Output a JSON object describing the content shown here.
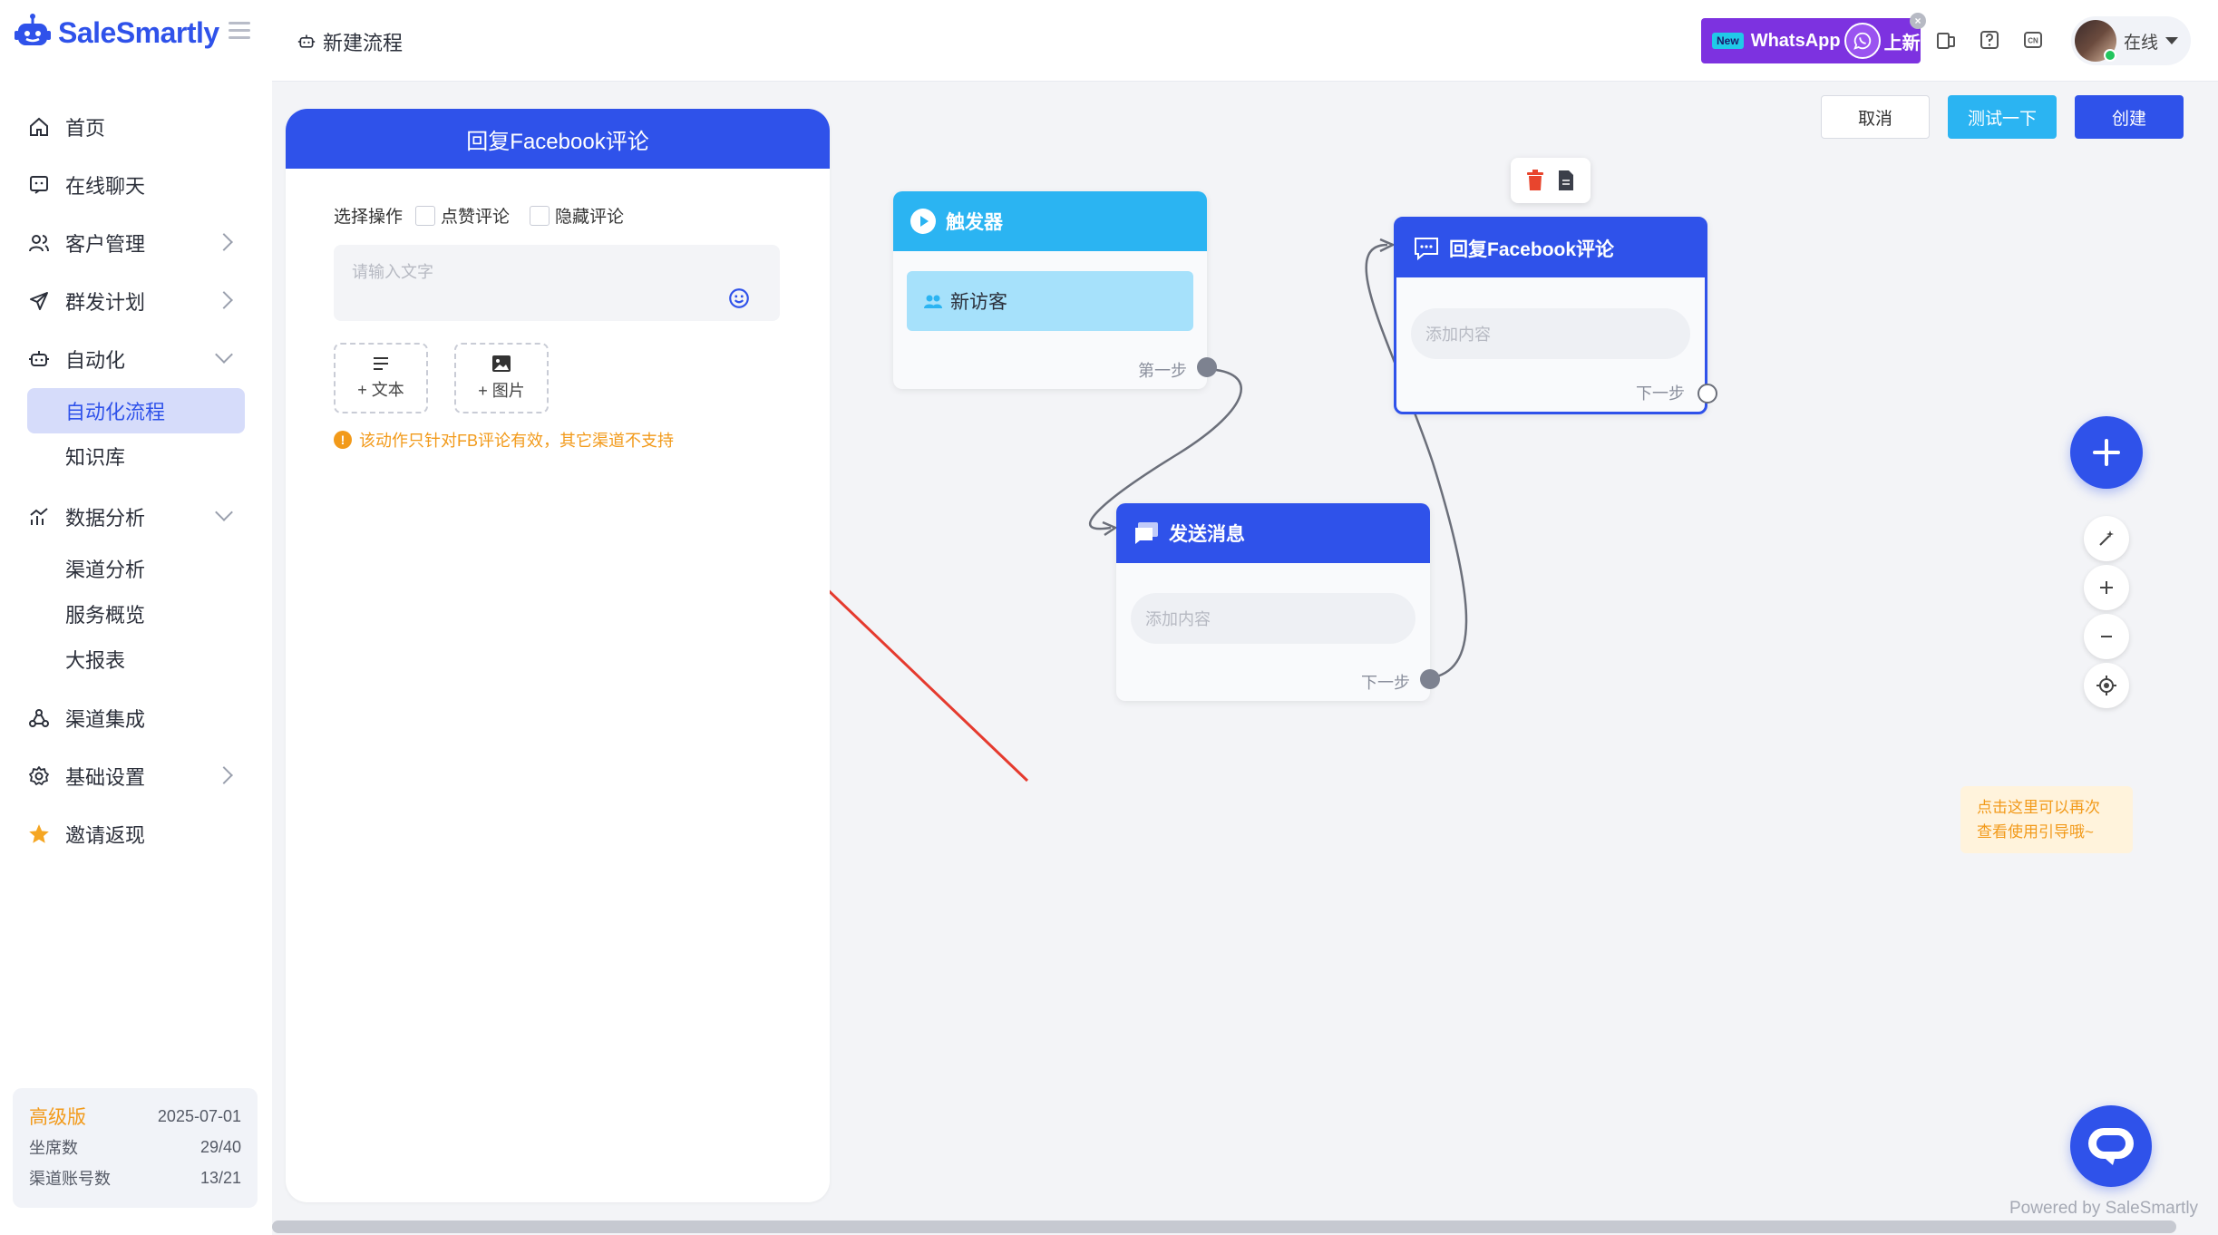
{
  "app": {
    "brand": "SaleSmartly"
  },
  "sidebar": {
    "items": [
      {
        "label": "首页"
      },
      {
        "label": "在线聊天"
      },
      {
        "label": "客户管理"
      },
      {
        "label": "群发计划"
      },
      {
        "label": "自动化"
      },
      {
        "label": "数据分析"
      },
      {
        "label": "渠道集成"
      },
      {
        "label": "基础设置"
      },
      {
        "label": "邀请返现"
      }
    ],
    "automation_sub": [
      {
        "label": "自动化流程"
      },
      {
        "label": "知识库"
      }
    ],
    "analysis_sub": [
      {
        "label": "渠道分析"
      },
      {
        "label": "服务概览"
      },
      {
        "label": "大报表"
      }
    ],
    "plan": {
      "tier": "高级版",
      "expiry": "2025-07-01",
      "seats_label": "坐席数",
      "seats_value": "29/40",
      "channels_label": "渠道账号数",
      "channels_value": "13/21"
    }
  },
  "topbar": {
    "breadcrumb": "新建流程",
    "banner": {
      "new_tag": "New",
      "text": "WhatsApp",
      "suffix": "上新"
    },
    "user": {
      "status": "在线"
    }
  },
  "toolbar": {
    "cancel": "取消",
    "test": "测试一下",
    "create": "创建"
  },
  "panel": {
    "title": "回复Facebook评论",
    "op_label": "选择操作",
    "options": [
      "点赞评论",
      "隐藏评论"
    ],
    "input_placeholder": "请输入文字",
    "add_text": "+ 文本",
    "add_image": "+ 图片",
    "warning": "该动作只针对FB评论有效，其它渠道不支持"
  },
  "nodes": {
    "trigger": {
      "title": "触发器",
      "chip": "新访客",
      "foot": "第一步"
    },
    "send": {
      "title": "发送消息",
      "placeholder": "添加内容",
      "foot": "下一步"
    },
    "reply": {
      "title": "回复Facebook评论",
      "placeholder": "添加内容",
      "foot": "下一步"
    }
  },
  "tip": {
    "line1": "点击这里可以再次",
    "line2": "查看使用引导哦~"
  },
  "footer": {
    "powered": "Powered by SaleSmartly"
  },
  "colors": {
    "primary": "#2f52ea",
    "trigger": "#2bb4f2",
    "warning": "#f29a1a",
    "annotation_arrow": "#e53a2e"
  }
}
